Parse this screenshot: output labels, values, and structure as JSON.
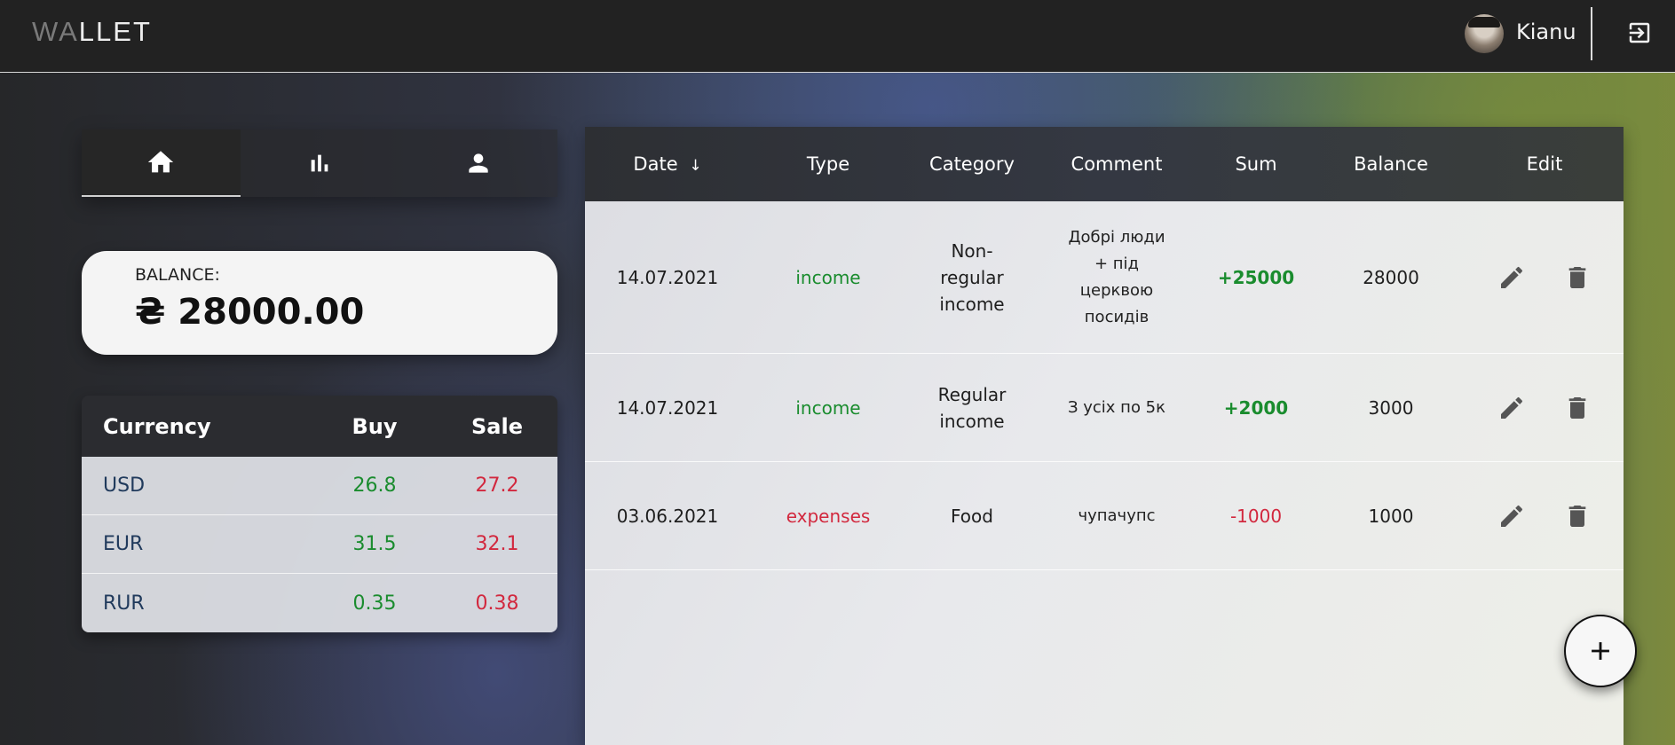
{
  "header": {
    "logo_dim": "WA",
    "logo_main": "LLET",
    "username": "Kianu"
  },
  "nav": {
    "tabs": [
      {
        "icon": "home-icon",
        "active": true
      },
      {
        "icon": "bar-chart-icon",
        "active": false
      },
      {
        "icon": "user-icon",
        "active": false
      }
    ]
  },
  "balance": {
    "label": "BALANCE:",
    "amount": "₴ 28000.00"
  },
  "currency": {
    "headers": [
      "Currency",
      "Buy",
      "Sale"
    ],
    "rows": [
      {
        "name": "USD",
        "buy": "26.8",
        "sale": "27.2"
      },
      {
        "name": "EUR",
        "buy": "31.5",
        "sale": "32.1"
      },
      {
        "name": "RUR",
        "buy": "0.35",
        "sale": "0.38"
      }
    ]
  },
  "transactions": {
    "headers": {
      "date": "Date",
      "sort_icon": "↓",
      "type": "Type",
      "category": "Category",
      "comment": "Comment",
      "sum": "Sum",
      "balance": "Balance",
      "edit": "Edit"
    },
    "rows": [
      {
        "date": "14.07.2021",
        "type": "income",
        "category_lines": [
          "Non-",
          "regular",
          "income"
        ],
        "comment_lines": [
          "Добрі люди",
          "+ під",
          "церквою",
          "посидів"
        ],
        "sum": "+25000",
        "balance": "28000"
      },
      {
        "date": "14.07.2021",
        "type": "income",
        "category_lines": [
          "Regular",
          "income"
        ],
        "comment_lines": [
          "З усіх по 5к"
        ],
        "sum": "+2000",
        "balance": "3000"
      },
      {
        "date": "03.06.2021",
        "type": "expenses",
        "category_lines": [
          "Food"
        ],
        "comment_lines": [
          "чупачупс"
        ],
        "sum": "-1000",
        "balance": "1000"
      }
    ]
  },
  "colors": {
    "income": "#1a8c2e",
    "expense": "#d2283e",
    "currency_name": "#203a5c"
  }
}
